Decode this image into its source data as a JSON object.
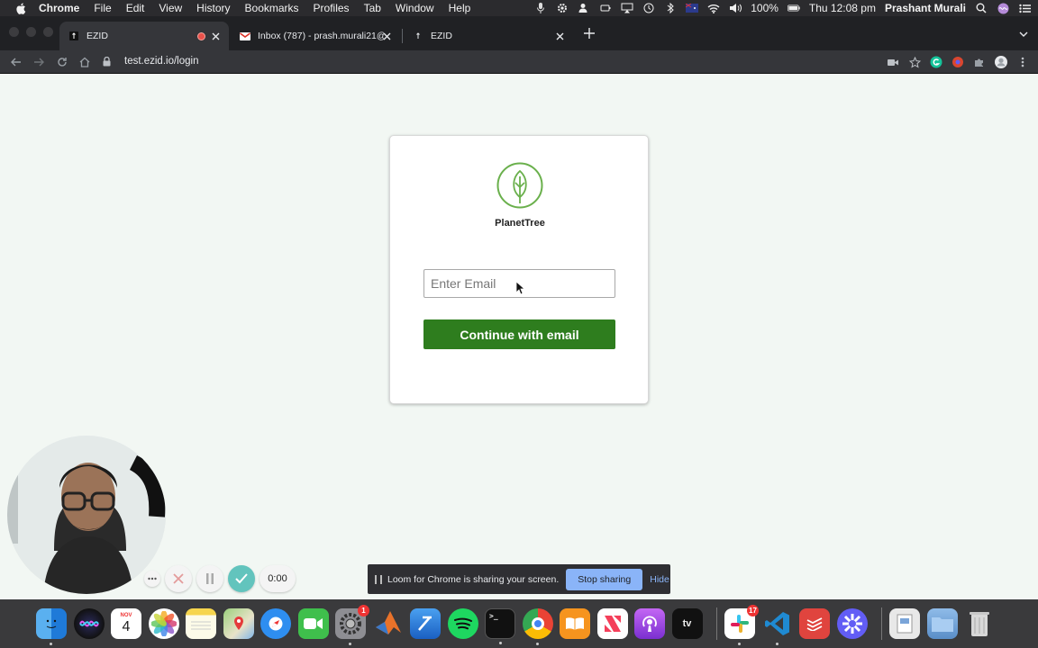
{
  "menubar": {
    "app_name": "Chrome",
    "items": [
      "File",
      "Edit",
      "View",
      "History",
      "Bookmarks",
      "Profiles",
      "Tab",
      "Window",
      "Help"
    ],
    "battery": "100%",
    "datetime": "Thu 12:08 pm",
    "user": "Prashant Murali"
  },
  "tabs": [
    {
      "title": "EZID",
      "active": true,
      "recording": true
    },
    {
      "title": "Inbox (787) - prash.murali21@...",
      "active": false
    },
    {
      "title": "EZID",
      "active": false
    }
  ],
  "toolbar": {
    "url": "test.ezid.io/login"
  },
  "login": {
    "brand": "PlanetTree",
    "email_placeholder": "Enter Email",
    "email_value": "",
    "continue_label": "Continue with email",
    "brand_color": "#2e7d1e"
  },
  "loom": {
    "timer": "0:00",
    "share_message": "Loom for Chrome is sharing your screen.",
    "stop_label": "Stop sharing",
    "hide_label": "Hide"
  },
  "dock": {
    "apps": [
      "Finder",
      "Siri",
      "Calendar",
      "Photos",
      "Notes",
      "Maps",
      "Safari",
      "FaceTime",
      "System Preferences",
      "MATLAB",
      "Xcode",
      "Spotify",
      "Terminal",
      "Chrome",
      "Books",
      "News",
      "Podcasts",
      "TV",
      "Slack",
      "VS Code",
      "Todoist",
      "Loom",
      "Preview",
      "Downloads",
      "Trash"
    ],
    "calendar_month": "NOV",
    "calendar_day": "4",
    "system_prefs_badge": "1",
    "slack_badge": "17"
  }
}
